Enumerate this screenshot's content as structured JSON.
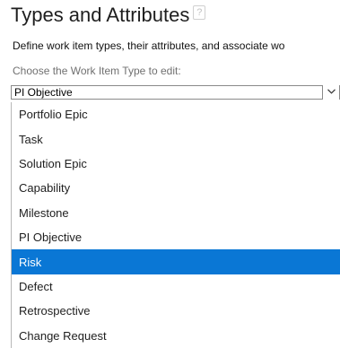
{
  "header": {
    "title": "Types and Attributes",
    "help_icon": "?"
  },
  "description": "Define work item types, their attributes, and associate wo",
  "selector": {
    "label": "Choose the Work Item Type to edit:",
    "current_value": "PI Objective",
    "arrow_icon": "chevron-down-icon"
  },
  "dropdown": {
    "options": [
      "Portfolio Epic",
      "Task",
      "Solution Epic",
      "Capability",
      "Milestone",
      "PI Objective",
      "Risk",
      "Defect",
      "Retrospective",
      "Change Request"
    ],
    "highlighted_option": "Risk"
  },
  "colors": {
    "highlight": "#0a77d5",
    "highlight_text": "#ffffff",
    "text": "#1e1e1e",
    "muted_text": "#707070",
    "border": "#8a8a8a"
  }
}
